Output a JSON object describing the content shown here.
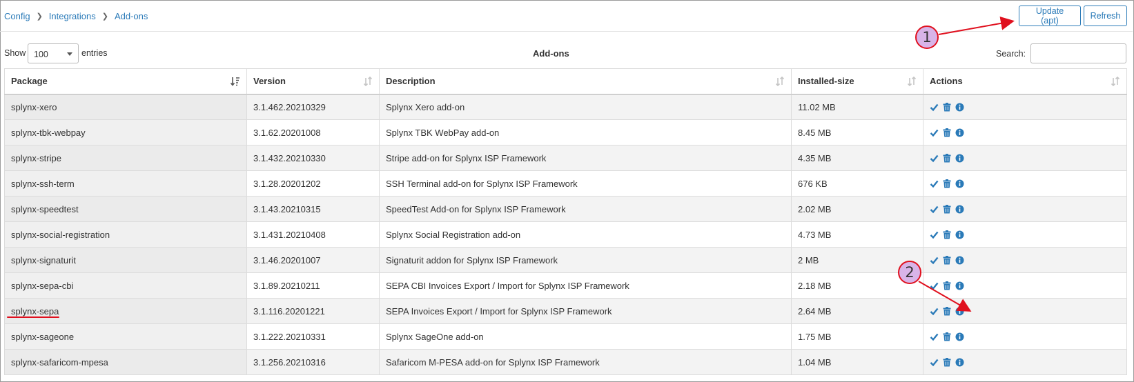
{
  "breadcrumb": [
    "Config",
    "Integrations",
    "Add-ons"
  ],
  "toolbar": {
    "update_label": "Update (apt)",
    "refresh_label": "Refresh"
  },
  "controls": {
    "show_label": "Show",
    "page_size": "100",
    "entries_label": "entries",
    "table_title": "Add-ons",
    "search_label": "Search:",
    "search_value": ""
  },
  "table": {
    "columns": [
      "Package",
      "Version",
      "Description",
      "Installed-size",
      "Actions"
    ],
    "rows": [
      {
        "package": "splynx-xero",
        "version": "3.1.462.20210329",
        "description": "Splynx Xero add-on",
        "size": "11.02 MB"
      },
      {
        "package": "splynx-tbk-webpay",
        "version": "3.1.62.20201008",
        "description": "Splynx TBK WebPay add-on",
        "size": "8.45 MB"
      },
      {
        "package": "splynx-stripe",
        "version": "3.1.432.20210330",
        "description": "Stripe add-on for Splynx ISP Framework",
        "size": "4.35 MB"
      },
      {
        "package": "splynx-ssh-term",
        "version": "3.1.28.20201202",
        "description": "SSH Terminal add-on for Splynx ISP Framework",
        "size": "676 KB"
      },
      {
        "package": "splynx-speedtest",
        "version": "3.1.43.20210315",
        "description": "SpeedTest Add-on for Splynx ISP Framework",
        "size": "2.02 MB"
      },
      {
        "package": "splynx-social-registration",
        "version": "3.1.431.20210408",
        "description": "Splynx Social Registration add-on",
        "size": "4.73 MB"
      },
      {
        "package": "splynx-signaturit",
        "version": "3.1.46.20201007",
        "description": "Signaturit addon for Splynx ISP Framework",
        "size": "2 MB"
      },
      {
        "package": "splynx-sepa-cbi",
        "version": "3.1.89.20210211",
        "description": "SEPA CBI Invoices Export / Import for Splynx ISP Framework",
        "size": "2.18 MB"
      },
      {
        "package": "splynx-sepa",
        "version": "3.1.116.20201221",
        "description": "SEPA Invoices Export / Import for Splynx ISP Framework",
        "size": "2.64 MB"
      },
      {
        "package": "splynx-sageone",
        "version": "3.1.222.20210331",
        "description": "Splynx SageOne add-on",
        "size": "1.75 MB"
      },
      {
        "package": "splynx-safaricom-mpesa",
        "version": "3.1.256.20210316",
        "description": "Safaricom M-PESA add-on for Splynx ISP Framework",
        "size": "1.04 MB"
      }
    ]
  },
  "annotations": {
    "marker_1": "1",
    "marker_2": "2"
  },
  "colors": {
    "link": "#2a7ab8",
    "annotation_red": "#e0101e",
    "annotation_fill": "#d8b4e8"
  },
  "icons": [
    "chevron-right-icon",
    "sort-icon",
    "install-check-icon",
    "delete-trash-icon",
    "info-icon"
  ]
}
